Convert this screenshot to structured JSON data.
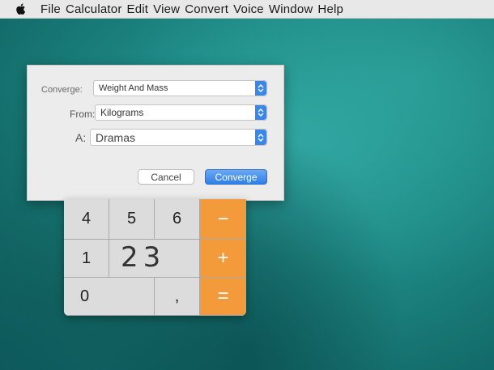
{
  "menubar": {
    "items": [
      "File",
      "Calculator",
      "Edit",
      "View",
      "Convert",
      "Voice",
      "Window",
      "Help"
    ]
  },
  "dialog": {
    "converge_label": "Converge:",
    "converge_value": "Weight And Mass",
    "from_label": "From:",
    "from_value": "Kilograms",
    "to_label": "A:",
    "to_value": "Dramas",
    "cancel_label": "Cancel",
    "converge_button": "Converge"
  },
  "calculator": {
    "row1": [
      "4",
      "5",
      "6",
      "−"
    ],
    "row2": [
      "1",
      "+"
    ],
    "display": "23",
    "row3": [
      "0",
      ",",
      "="
    ]
  }
}
